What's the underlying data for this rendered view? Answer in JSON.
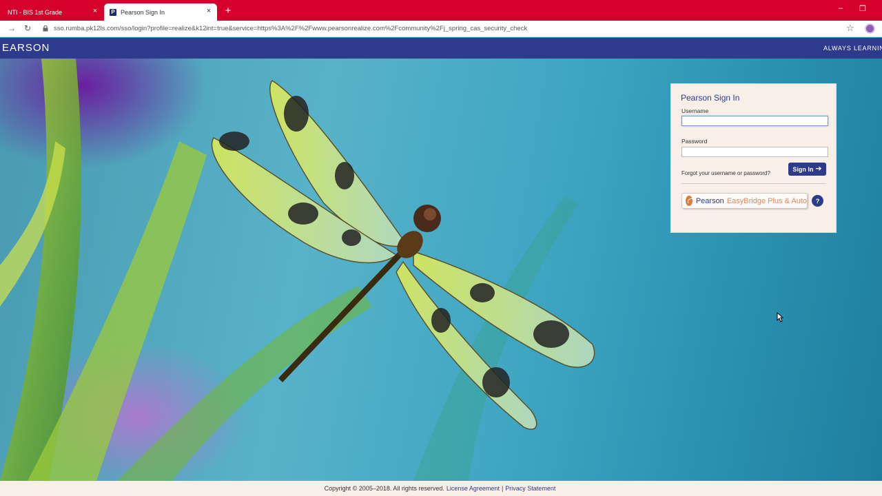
{
  "browser": {
    "tabs": [
      {
        "title": "NTI - BIS 1st Grade",
        "active": false
      },
      {
        "title": "Pearson Sign In",
        "active": true
      }
    ],
    "favicon_letter": "P",
    "new_tab_symbol": "+",
    "close_symbol": "×",
    "url": "sso.rumba.pk12ls.com/sso/login?profile=realize&k12int=true&service=https%3A%2F%2Fwww.pearsonrealize.com%2Fcommunity%2Fj_spring_cas_security_check",
    "icons": [
      "back-icon",
      "forward-icon",
      "reload-icon",
      "lock-icon",
      "star-icon",
      "profile-icon"
    ],
    "accent_color": "#d6002c"
  },
  "header": {
    "logo": "EARSON",
    "tagline": "ALWAYS LEARNIN",
    "color": "#2e3a8c"
  },
  "signin": {
    "title": "Pearson Sign In",
    "username_label": "Username",
    "username_value": "",
    "password_label": "Password",
    "password_value": "",
    "forgot_link": "Forgot your username or password?",
    "signin_button": "Sign In",
    "easybridge": {
      "brand": "Pearson",
      "product": "EasyBridge Plus & Auto"
    },
    "help_symbol": "?"
  },
  "footer": {
    "copyright": "Copyright © 2005–2018. All rights reserved.",
    "license_link": "License Agreement",
    "separator": "|",
    "privacy_link": "Privacy Statement"
  }
}
